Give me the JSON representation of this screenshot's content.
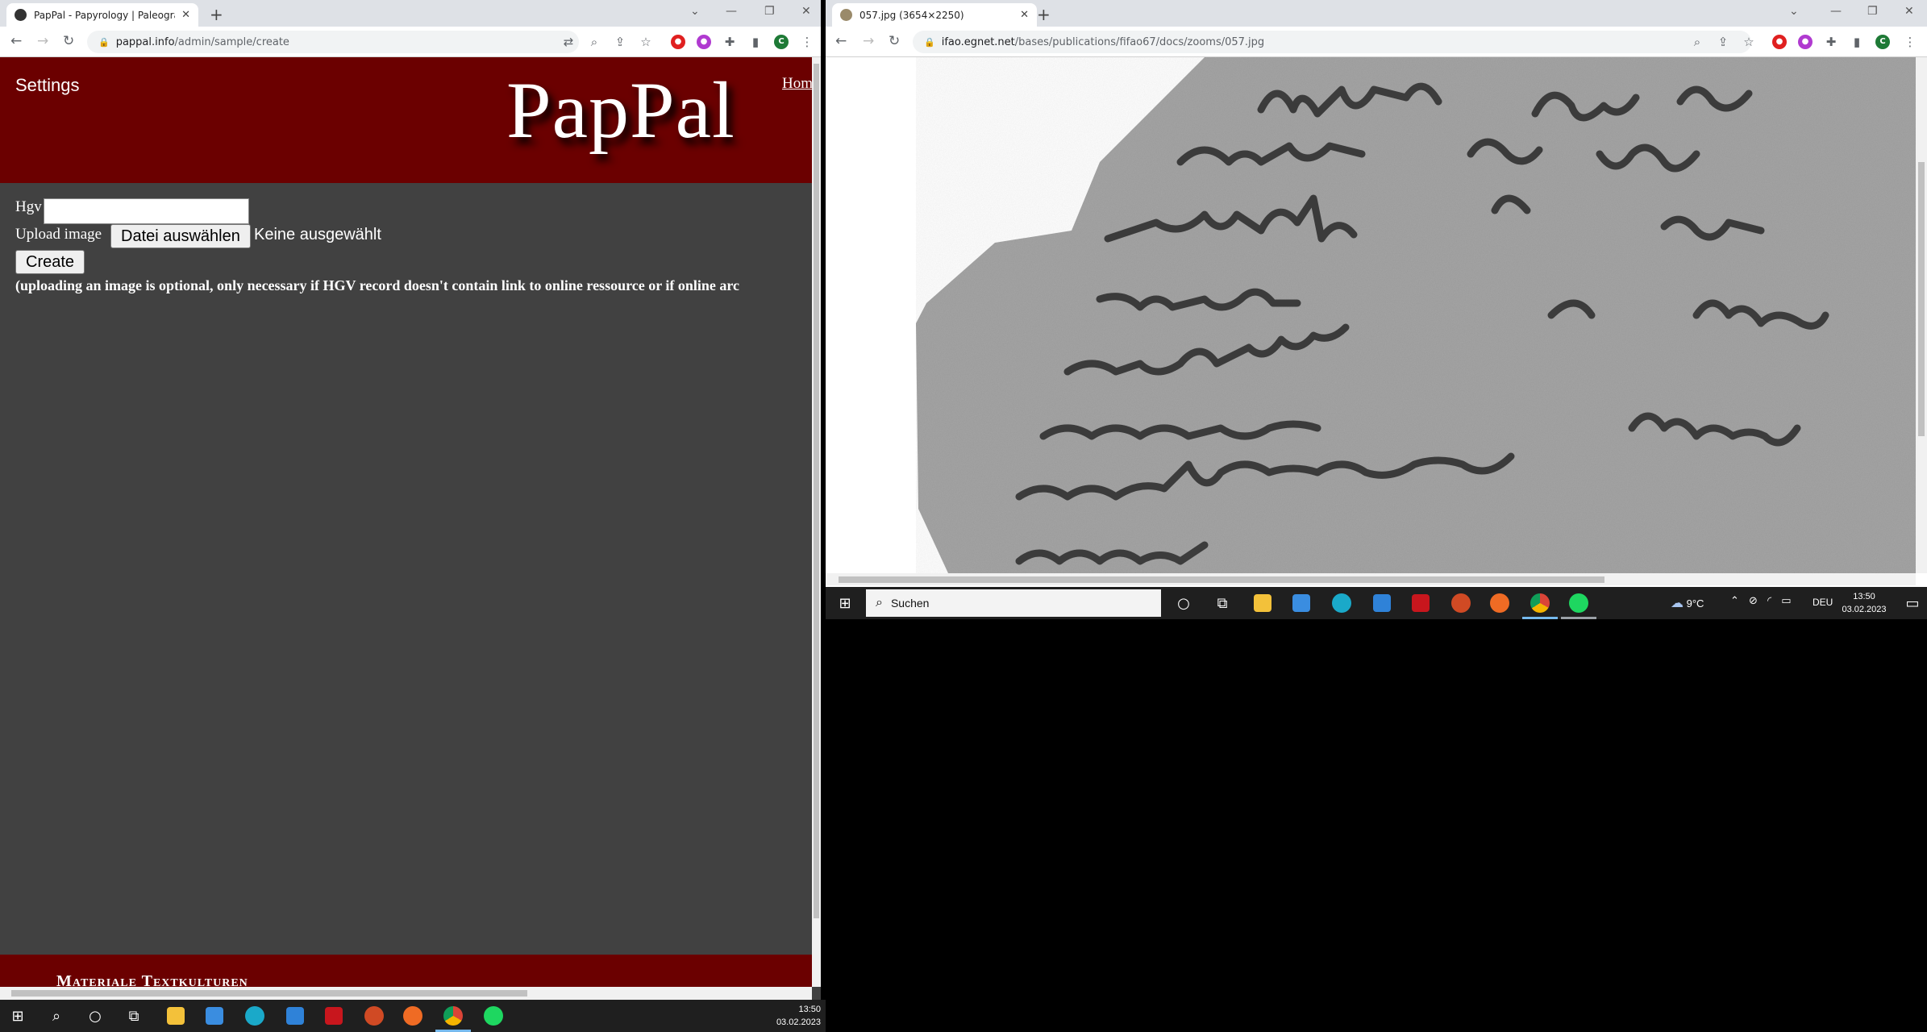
{
  "left_browser": {
    "tab": {
      "title": "PapPal - Papyrology | Paleograph",
      "close": "✕"
    },
    "new_tab": "+",
    "window_controls": {
      "minimize": "—",
      "restore": "❐",
      "close": "✕",
      "dropdown": "⌄"
    },
    "url": {
      "host": "pappal.info",
      "path": "/admin/sample/create"
    },
    "profile_initial": "C"
  },
  "site": {
    "settings_label": "Settings",
    "logo_text": "PapPal",
    "home_link": "Hom",
    "form": {
      "hgv_label": "Hgv",
      "hgv_value": "",
      "upload_label": "Upload image",
      "file_button": "Datei auswählen",
      "file_status": "Keine ausgewählt",
      "create_button": "Create",
      "note": "(uploading an image is optional, only necessary if HGV record doesn't contain link to online ressource or if online arc"
    },
    "footer_title": "Materiale Textkulturen"
  },
  "left_taskbar": {
    "time": "13:50",
    "date": "03.02.2023"
  },
  "right_browser": {
    "tab": {
      "title": "057.jpg (3654×2250)",
      "close": "✕"
    },
    "new_tab": "+",
    "window_controls": {
      "minimize": "—",
      "restore": "❐",
      "close": "✕",
      "dropdown": "⌄"
    },
    "url": {
      "host": "ifao.egnet.net",
      "path": "/bases/publications/fifao67/docs/zooms/057.jpg"
    },
    "profile_initial": "C"
  },
  "right_taskbar": {
    "search_placeholder": "Suchen",
    "weather": "9°C",
    "language": "DEU",
    "time": "13:50",
    "date": "03.02.2023"
  },
  "colors": {
    "brand_red": "#6b0000",
    "page_bg": "#414141",
    "taskbar": "#1f1f1f"
  }
}
